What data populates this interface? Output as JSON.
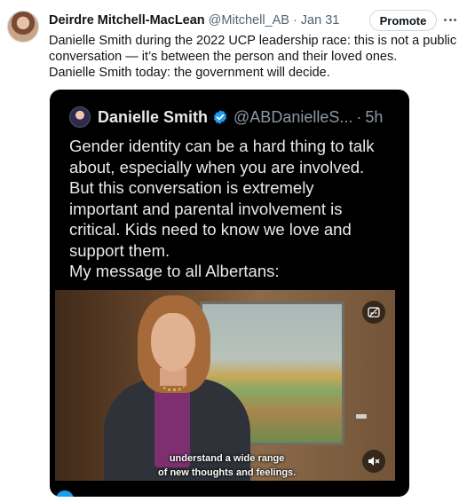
{
  "tweet": {
    "author_name": "Deirdre Mitchell-MacLean",
    "author_handle": "@Mitchell_AB",
    "separator": "·",
    "timestamp": "Jan 31",
    "promote_label": "Promote",
    "text_lines": [
      "Danielle Smith during the 2022 UCP leadership race: this is not a public",
      "conversation — it’s between the person and their loved ones.",
      "Danielle Smith today: the government will decide."
    ]
  },
  "quote": {
    "author_name": "Danielle Smith",
    "author_handle": "@ABDanielleS...",
    "separator": "·",
    "timestamp": "5h",
    "text_lines": [
      "Gender identity can be a hard thing to talk",
      "about, especially when you are involved.",
      "But this conversation is extremely",
      "important and parental involvement is",
      "critical. Kids need to know we love and",
      "support them.",
      "My message to all Albertans:"
    ],
    "video": {
      "subtitle_lines": [
        "understand a wide range",
        "of new thoughts and feelings."
      ]
    }
  },
  "icons": {
    "more": "more-horizontal-icon",
    "verified": "verified-badge-icon",
    "captions": "captions-icon",
    "mute": "muted-speaker-icon"
  },
  "colors": {
    "verified": "#1d9bf0",
    "quote_background": "#000000",
    "secondary_text": "#536471"
  }
}
